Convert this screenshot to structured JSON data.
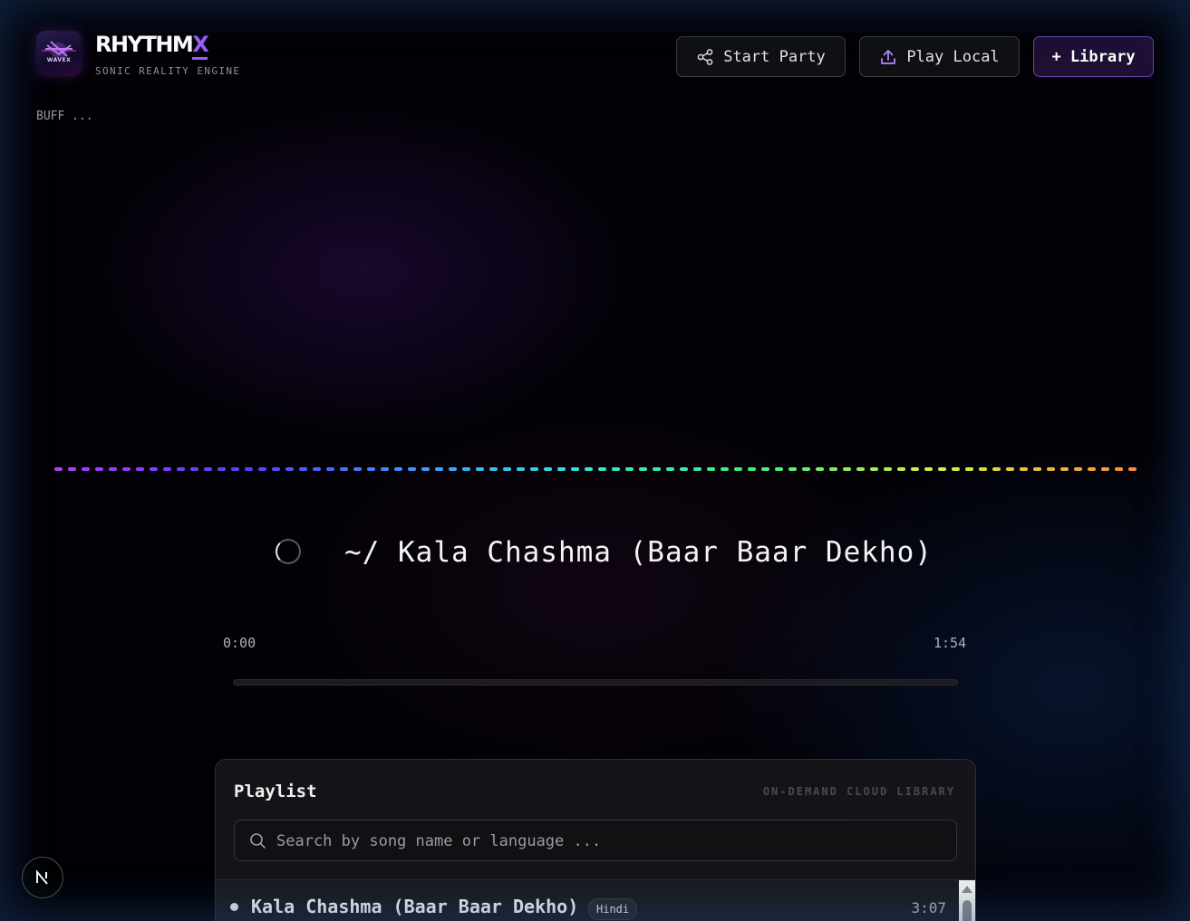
{
  "header": {
    "brand_name": "RHYTHM",
    "brand_name_accent": "X",
    "logo_text": "WAVEX",
    "tagline": "SONIC REALITY ENGINE",
    "buffer_status": "BUFF ...",
    "buttons": {
      "start_party": {
        "label": "Start Party",
        "icon": "share-icon"
      },
      "play_local": {
        "label": "Play Local",
        "icon": "upload-icon"
      },
      "library": {
        "label": "+ Library"
      }
    },
    "accent_color": "#9d5cff"
  },
  "visualizer": {
    "gradient_colors": [
      "#b13cff",
      "#5a3cff",
      "#3ca0ff",
      "#2ee8d8",
      "#3cf07a",
      "#d8f03c",
      "#ff8a3c"
    ]
  },
  "now_playing": {
    "title": "~/ Kala Chashma (Baar Baar Dekho)",
    "time_current": "0:00",
    "time_total": "1:54",
    "progress": 0
  },
  "playlist": {
    "title": "Playlist",
    "subtitle": "ON-DEMAND CLOUD LIBRARY",
    "search_placeholder": "Search by song name or language ...",
    "tracks": [
      {
        "name": "Kala Chashma (Baar Baar Dekho)",
        "language": "Hindi",
        "duration": "3:07"
      }
    ]
  },
  "dev_indicator": {
    "icon": "nextjs-logo-icon"
  }
}
